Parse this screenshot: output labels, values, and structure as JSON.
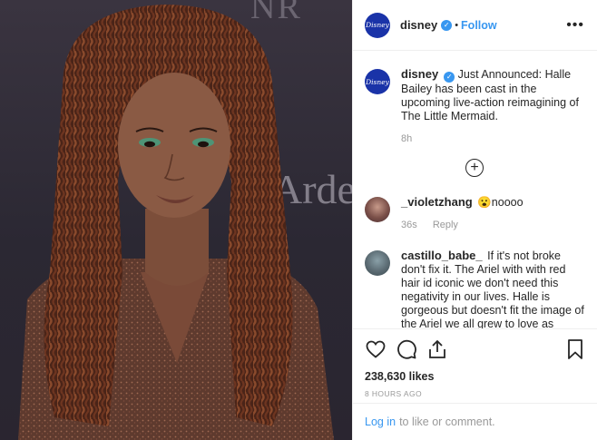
{
  "post": {
    "account": "disney",
    "avatar_text": "Disney",
    "verified_icon": "verified-badge-icon",
    "separator": "•",
    "follow_label": "Follow",
    "more_label": "•••",
    "photo": {
      "backdrop_text_1": "Arde",
      "backdrop_text_2": "NR",
      "colors": {
        "backdrop": "#2b2833",
        "hair": "#5a2e20",
        "skin": "#8a5a44",
        "dress": "#5e3a2e"
      }
    }
  },
  "caption": {
    "username": "disney",
    "text": "Just Announced: Halle Bailey has been cast in the upcoming live-action reimagining of The Little Mermaid.",
    "age": "8h"
  },
  "load_more_icon": "plus-circle-icon",
  "comments": [
    {
      "username": "_violetzhang",
      "text": "😮noooo",
      "age": "36s",
      "reply_label": "Reply"
    },
    {
      "username": "castillo_babe_",
      "text": "If it's not broke don't fix it. The Ariel with with red hair id iconic we don't need this negativity in our lives. Halle is gorgeous but doesn't fit the image of the Ariel we all grew to love as children."
    }
  ],
  "actions": {
    "icons": [
      "heart-icon",
      "comment-icon",
      "share-icon",
      "bookmark-icon"
    ],
    "likes": "238,630 likes",
    "timestamp": "8 HOURS AGO"
  },
  "login": {
    "link": "Log in",
    "text": "to like or comment."
  },
  "colors": {
    "accent": "#3897f0",
    "text": "#262626",
    "muted": "#999999",
    "border": "#efefef",
    "avatar": "#1a33a8"
  }
}
